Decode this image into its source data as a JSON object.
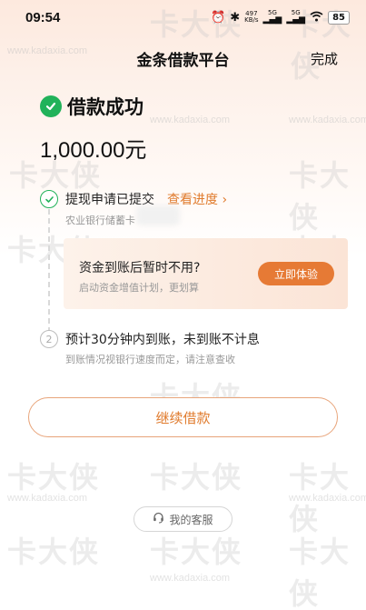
{
  "status_bar": {
    "time": "09:54",
    "speed_value": "497",
    "speed_unit": "KB/s",
    "sig1_label": "5G",
    "sig2_label": "5G",
    "battery": "85"
  },
  "nav": {
    "title": "金条借款平台",
    "done_label": "完成"
  },
  "result": {
    "title": "借款成功",
    "amount": "1,000.00元"
  },
  "steps": [
    {
      "title": "提现申请已提交",
      "link_label": "查看进度 ›",
      "sub": "农业银行储蓄卡"
    },
    {
      "number": "2",
      "title": "预计30分钟内到账，未到账不计息",
      "sub": "到账情况视银行速度而定，请注意查收"
    }
  ],
  "promo": {
    "title": "资金到账后暂时不用?",
    "sub": "启动资金增值计划，更划算",
    "button_label": "立即体验"
  },
  "actions": {
    "continue_label": "继续借款",
    "service_label": "我的客服"
  },
  "watermark": {
    "text": "卡大侠",
    "url": "www.kadaxia.com"
  },
  "colors": {
    "accent": "#e07b2d",
    "success": "#21b25a",
    "promo_button": "#e67a35"
  }
}
